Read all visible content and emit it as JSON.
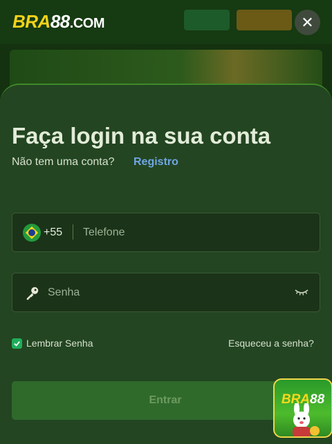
{
  "brand": {
    "prefix": "BRA",
    "number": "88",
    "domain": ".COM"
  },
  "close_icon": "close-icon",
  "login": {
    "title": "Faça login na sua conta",
    "subtitle": "Não tem uma conta?",
    "register_link": "Registro",
    "phone": {
      "country_code": "+55",
      "placeholder": "Telefone",
      "value": "",
      "flag_icon": "brazil-flag-icon"
    },
    "password": {
      "placeholder": "Senha",
      "value": "",
      "key_icon": "key-icon",
      "toggle_icon": "eye-closed-icon"
    },
    "remember_label": "Lembrar Senha",
    "remember_checked": true,
    "forgot_link": "Esqueceu a senha?",
    "submit_label": "Entrar"
  },
  "app_badge": {
    "prefix": "BRA",
    "number": "88"
  },
  "colors": {
    "accent_green": "#1fae5a",
    "link_blue": "#6ea6e6",
    "brand_yellow": "#f3d21a",
    "sheet_bg": "#234521"
  }
}
